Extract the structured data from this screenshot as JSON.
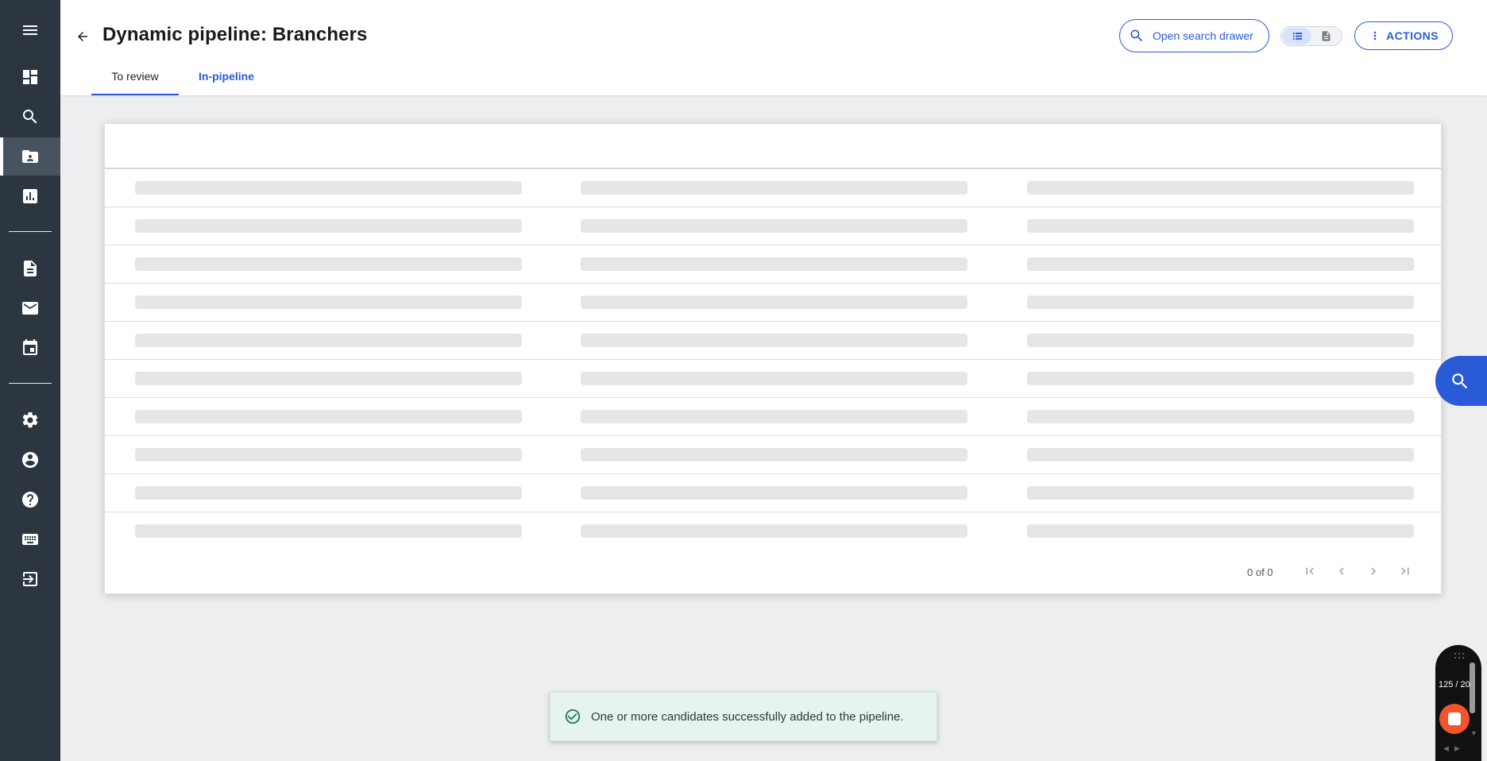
{
  "sidebar": {
    "items": [
      {
        "name": "menu",
        "icon": "hamburger-menu-icon"
      },
      {
        "name": "dashboard",
        "icon": "dashboard-icon"
      },
      {
        "name": "search",
        "icon": "search-icon"
      },
      {
        "name": "pipelines",
        "icon": "contacts-folder-icon",
        "active": true
      },
      {
        "name": "reports",
        "icon": "bar-chart-icon"
      },
      {
        "name": "documents",
        "icon": "document-icon"
      },
      {
        "name": "mail",
        "icon": "mail-icon"
      },
      {
        "name": "calendar",
        "icon": "calendar-icon"
      },
      {
        "name": "settings",
        "icon": "gear-icon"
      },
      {
        "name": "account",
        "icon": "account-circle-icon"
      },
      {
        "name": "help",
        "icon": "help-circle-icon"
      },
      {
        "name": "keyboard",
        "icon": "keyboard-icon"
      },
      {
        "name": "logout",
        "icon": "logout-icon"
      }
    ]
  },
  "header": {
    "title": "Dynamic pipeline: Branchers",
    "back_icon": "arrow-left-icon",
    "tabs": [
      {
        "label": "To review",
        "active": true
      },
      {
        "label": "In-pipeline",
        "active": false
      }
    ],
    "search_drawer_label": "Open search drawer",
    "actions_label": "ACTIONS",
    "view_toggle": {
      "selected": "list",
      "options": [
        "list-view-icon",
        "document-view-icon"
      ]
    }
  },
  "table": {
    "state": "loading",
    "skeleton_rows": 10,
    "skeleton_columns": 3,
    "pagination": {
      "range_text": "0 of 0"
    }
  },
  "toast": {
    "icon": "check-circle-icon",
    "message": "One or more candidates successfully added to the pipeline."
  },
  "recorder": {
    "counter": "125 / 20"
  },
  "colors": {
    "sidebar_bg": "#2b3640",
    "accent": "#2a5bd7",
    "page_bg": "#eceeef",
    "toast_bg": "#e7f3ee",
    "record_stop": "#f0552e"
  }
}
